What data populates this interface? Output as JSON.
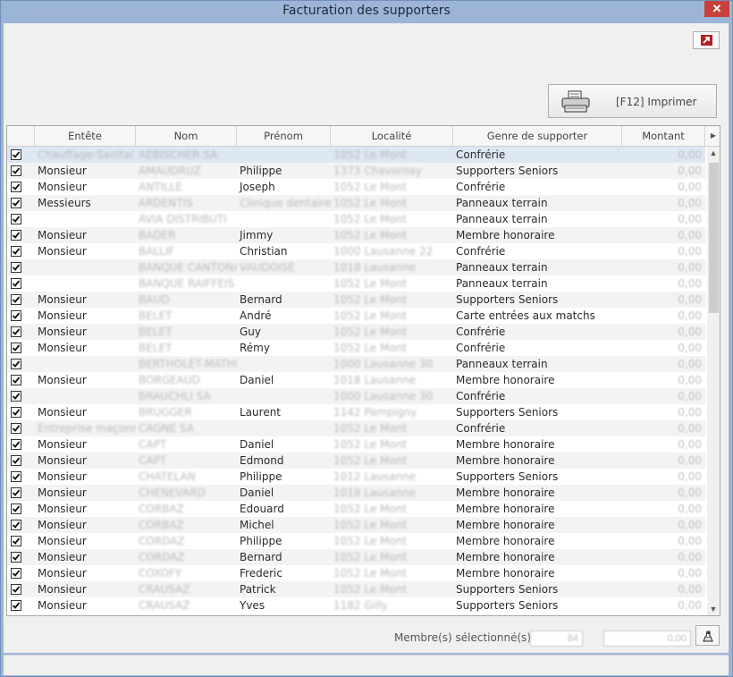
{
  "window": {
    "title": "Facturation des supporters",
    "close_label": "✕"
  },
  "toolbar": {
    "print_label": "[F12] Imprimer"
  },
  "table": {
    "columns": [
      "",
      "Entête",
      "Nom",
      "Prénom",
      "Localité",
      "Genre de supporter",
      "Montant"
    ],
    "rows": [
      {
        "checked": true,
        "entete": "Chauffage-Sanitai",
        "nom": "AEBISCHER SA",
        "prenom": "",
        "localite": "1052 Le Mont",
        "genre": "Confrérie",
        "montant": "0,00"
      },
      {
        "checked": true,
        "entete": "Monsieur",
        "nom": "AMAUDRUZ",
        "prenom": "Philippe",
        "localite": "1373 Chavornay",
        "genre": "Supporters Seniors",
        "montant": "0,00"
      },
      {
        "checked": true,
        "entete": "Monsieur",
        "nom": "ANTILLE",
        "prenom": "Joseph",
        "localite": "1052 Le Mont",
        "genre": "Confrérie",
        "montant": "0,00"
      },
      {
        "checked": true,
        "entete": "Messieurs",
        "nom": "ARDENTIS",
        "prenom": "Clinique dentaire",
        "localite": "1052 Le Mont",
        "genre": "Panneaux terrain",
        "montant": "0,00"
      },
      {
        "checked": true,
        "entete": "",
        "nom": "AVIA DISTRIBUTI",
        "prenom": "",
        "localite": "1052 Le Mont",
        "genre": "Panneaux terrain",
        "montant": "0,00"
      },
      {
        "checked": true,
        "entete": "Monsieur",
        "nom": "BADER",
        "prenom": "Jimmy",
        "localite": "1052 Le Mont",
        "genre": "Membre honoraire",
        "montant": "0,00"
      },
      {
        "checked": true,
        "entete": "Monsieur",
        "nom": "BALLIF",
        "prenom": "Christian",
        "localite": "1000 Lausanne 22",
        "genre": "Confrérie",
        "montant": "0,00"
      },
      {
        "checked": true,
        "entete": "",
        "nom": "BANQUE CANTONA",
        "prenom": "VAUDOISE",
        "localite": "1018 Lausanne",
        "genre": "Panneaux terrain",
        "montant": "0,00"
      },
      {
        "checked": true,
        "entete": "",
        "nom": "BANQUE RAIFFEIS",
        "prenom": "",
        "localite": "1052 Le Mont",
        "genre": "Panneaux terrain",
        "montant": "0,00"
      },
      {
        "checked": true,
        "entete": "Monsieur",
        "nom": "BAUD",
        "prenom": "Bernard",
        "localite": "1052 Le Mont",
        "genre": "Supporters Seniors",
        "montant": "0,00"
      },
      {
        "checked": true,
        "entete": "Monsieur",
        "nom": "BELET",
        "prenom": "André",
        "localite": "1052 Le Mont",
        "genre": "Carte entrées aux matchs",
        "montant": "0,00"
      },
      {
        "checked": true,
        "entete": "Monsieur",
        "nom": "BELET",
        "prenom": "Guy",
        "localite": "1052 Le Mont",
        "genre": "Confrérie",
        "montant": "0,00"
      },
      {
        "checked": true,
        "entete": "Monsieur",
        "nom": "BELET",
        "prenom": "Rémy",
        "localite": "1052 Le Mont",
        "genre": "Confrérie",
        "montant": "0,00"
      },
      {
        "checked": true,
        "entete": "",
        "nom": "BERTHOLET-MATHI",
        "prenom": "",
        "localite": "1000 Lausanne 30",
        "genre": "Panneaux terrain",
        "montant": "0,00"
      },
      {
        "checked": true,
        "entete": "Monsieur",
        "nom": "BORGEAUD",
        "prenom": "Daniel",
        "localite": "1018 Lausanne",
        "genre": "Membre honoraire",
        "montant": "0,00"
      },
      {
        "checked": true,
        "entete": "",
        "nom": "BRAUCHLI SA",
        "prenom": "",
        "localite": "1000 Lausanne 30",
        "genre": "Confrérie",
        "montant": "0,00"
      },
      {
        "checked": true,
        "entete": "Monsieur",
        "nom": "BRUGGER",
        "prenom": "Laurent",
        "localite": "1142 Pampigny",
        "genre": "Supporters Seniors",
        "montant": "0,00"
      },
      {
        "checked": true,
        "entete": "Entreprise maçonn",
        "nom": "CAGNE SA",
        "prenom": "",
        "localite": "1052 Le Mont",
        "genre": "Confrérie",
        "montant": "0,00"
      },
      {
        "checked": true,
        "entete": "Monsieur",
        "nom": "CAPT",
        "prenom": "Daniel",
        "localite": "1052 Le Mont",
        "genre": "Membre honoraire",
        "montant": "0,00"
      },
      {
        "checked": true,
        "entete": "Monsieur",
        "nom": "CAPT",
        "prenom": "Edmond",
        "localite": "1052 Le Mont",
        "genre": "Membre honoraire",
        "montant": "0,00"
      },
      {
        "checked": true,
        "entete": "Monsieur",
        "nom": "CHATELAN",
        "prenom": "Philippe",
        "localite": "1012 Lausanne",
        "genre": "Supporters Seniors",
        "montant": "0,00"
      },
      {
        "checked": true,
        "entete": "Monsieur",
        "nom": "CHENEVARD",
        "prenom": "Daniel",
        "localite": "1018 Lausanne",
        "genre": "Membre honoraire",
        "montant": "0,00"
      },
      {
        "checked": true,
        "entete": "Monsieur",
        "nom": "CORBAZ",
        "prenom": "Edouard",
        "localite": "1052 Le Mont",
        "genre": "Membre honoraire",
        "montant": "0,00"
      },
      {
        "checked": true,
        "entete": "Monsieur",
        "nom": "CORBAZ",
        "prenom": "Michel",
        "localite": "1052 Le Mont",
        "genre": "Membre honoraire",
        "montant": "0,00"
      },
      {
        "checked": true,
        "entete": "Monsieur",
        "nom": "CORDAZ",
        "prenom": "Philippe",
        "localite": "1052 Le Mont",
        "genre": "Membre honoraire",
        "montant": "0,00"
      },
      {
        "checked": true,
        "entete": "Monsieur",
        "nom": "CORDAZ",
        "prenom": "Bernard",
        "localite": "1052 Le Mont",
        "genre": "Membre honoraire",
        "montant": "0,00"
      },
      {
        "checked": true,
        "entete": "Monsieur",
        "nom": "COXOFY",
        "prenom": "Frederic",
        "localite": "1052 Le Mont",
        "genre": "Membre honoraire",
        "montant": "0,00"
      },
      {
        "checked": true,
        "entete": "Monsieur",
        "nom": "CRAUSAZ",
        "prenom": "Patrick",
        "localite": "1052 Le Mont",
        "genre": "Supporters Seniors",
        "montant": "0,00"
      },
      {
        "checked": true,
        "entete": "Monsieur",
        "nom": "CRAUSAZ",
        "prenom": "Yves",
        "localite": "1182 Gilly",
        "genre": "Supporters Seniors",
        "montant": "0,00"
      }
    ]
  },
  "footer": {
    "selected_label": "Membre(s) sélectionné(s)",
    "selected_count": "84",
    "total": "0,00"
  }
}
